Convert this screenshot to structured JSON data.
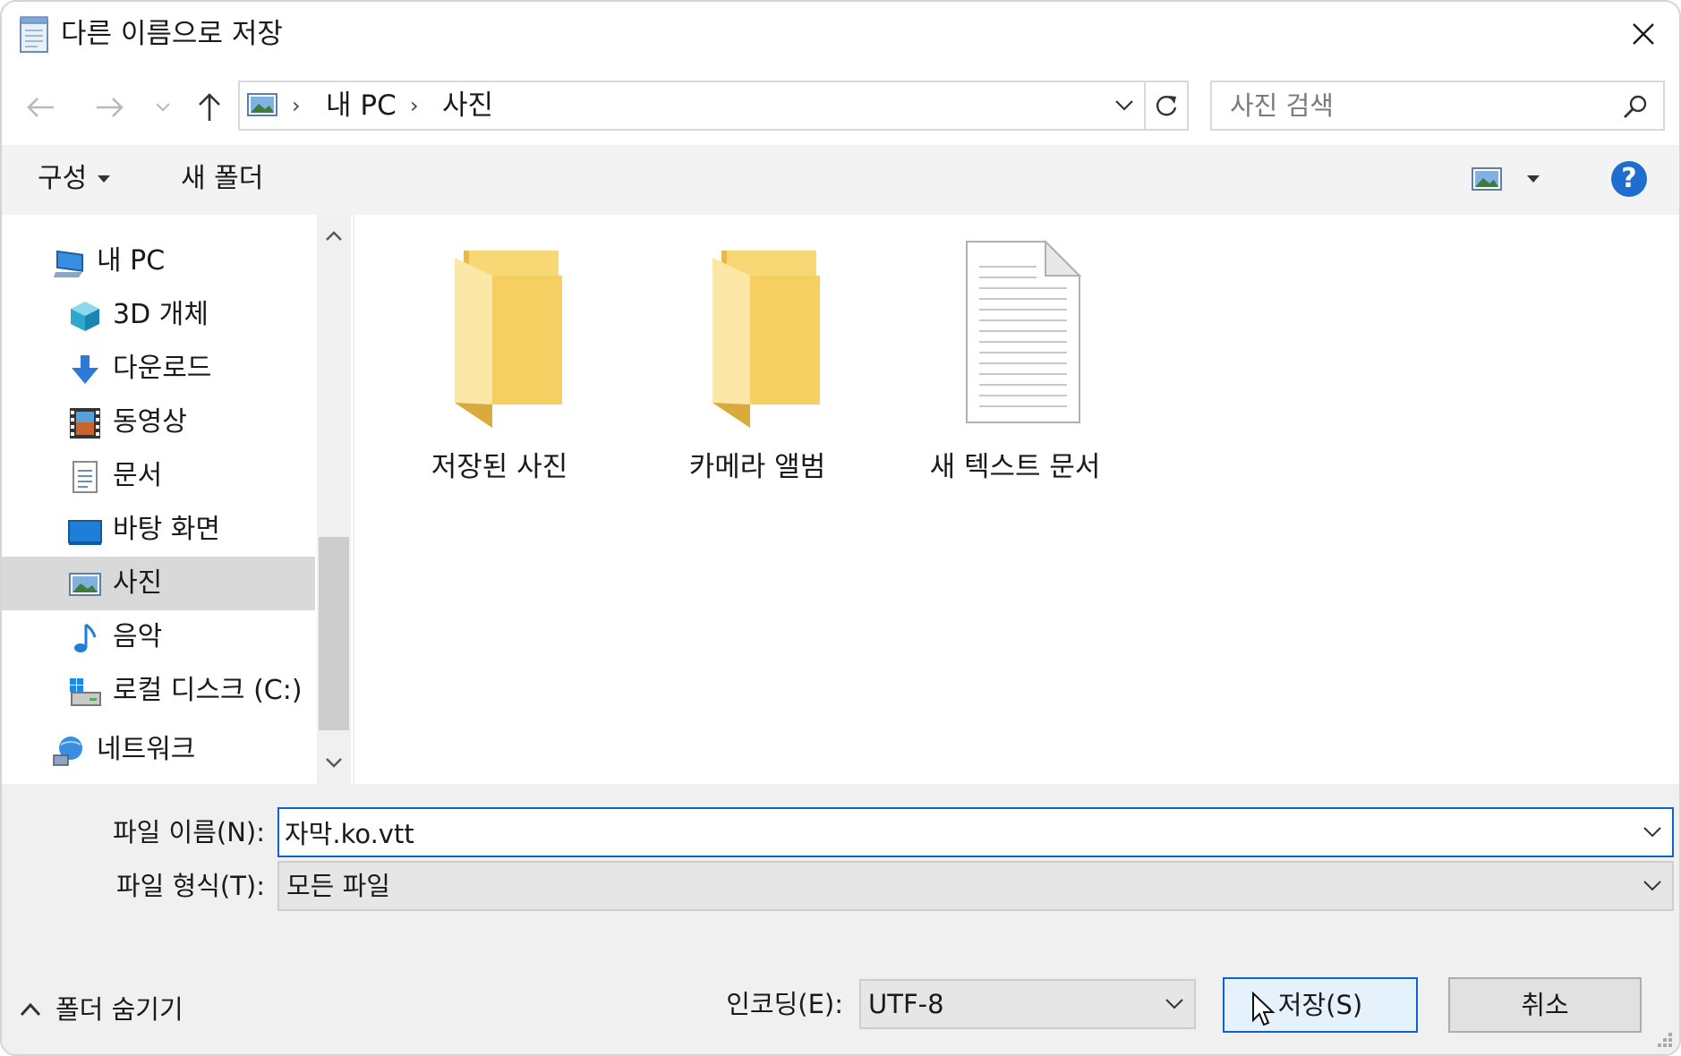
{
  "window": {
    "title": "다른 이름으로 저장",
    "icons": {
      "app": "notepad-icon",
      "close": "close-icon"
    }
  },
  "nav": {
    "back": "back-arrow-icon",
    "forward": "forward-arrow-icon",
    "recent": "chevron-down-icon",
    "up": "up-arrow-icon",
    "breadcrumb": [
      "내 PC",
      "사진"
    ],
    "search_placeholder": "사진 검색"
  },
  "commands": {
    "organize": "구성",
    "new_folder": "새 폴더",
    "help": "?"
  },
  "sidebar": {
    "items": [
      {
        "label": "내 PC",
        "icon": "pc-icon"
      },
      {
        "label": "3D 개체",
        "icon": "3d-objects-icon"
      },
      {
        "label": "다운로드",
        "icon": "download-icon"
      },
      {
        "label": "동영상",
        "icon": "video-icon"
      },
      {
        "label": "문서",
        "icon": "documents-icon"
      },
      {
        "label": "바탕 화면",
        "icon": "desktop-icon"
      },
      {
        "label": "사진",
        "icon": "pictures-icon",
        "selected": true
      },
      {
        "label": "음악",
        "icon": "music-icon"
      },
      {
        "label": "로컬 디스크 (C:)",
        "icon": "local-disk-icon"
      },
      {
        "label": "네트워크",
        "icon": "network-icon"
      }
    ]
  },
  "files": [
    {
      "name": "저장된 사진",
      "type": "folder"
    },
    {
      "name": "카메라 앨범",
      "type": "folder"
    },
    {
      "name": "새 텍스트 문서",
      "type": "text-document"
    }
  ],
  "form": {
    "filename_label": "파일 이름(N):",
    "filename_value": "자막.ko.vtt",
    "filetype_label": "파일 형식(T):",
    "filetype_value": "모든 파일",
    "hide_folders": "폴더 숨기기",
    "encoding_label": "인코딩(E):",
    "encoding_value": "UTF-8",
    "save": "저장(S)",
    "cancel": "취소"
  },
  "colors": {
    "accent": "#0a64d0",
    "folder": "#f8d775",
    "selected": "#d9d9d9",
    "help": "#1e6ed0"
  }
}
